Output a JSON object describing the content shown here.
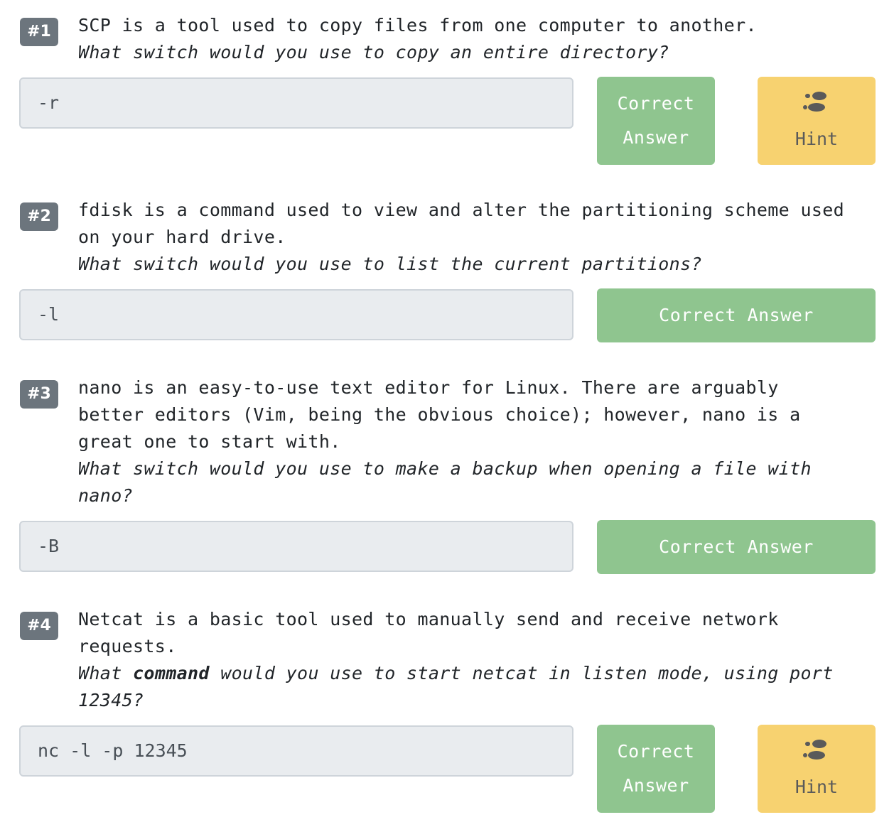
{
  "questions": [
    {
      "badge": "#1",
      "statement": "SCP is a tool used to copy files from one computer to another.",
      "ask": "What switch would you use to copy an entire directory?",
      "answer": "-r",
      "correct_label_line1": "Correct",
      "correct_label_line2": "Answer",
      "hint_label": "Hint",
      "hint_icon": "footprints-icon"
    },
    {
      "badge": "#2",
      "statement_line1": "fdisk is a command used to view and alter the partitioning scheme used",
      "statement_line2": "on your hard drive.",
      "ask": "What switch would you use to list the current partitions?",
      "answer": "-l",
      "correct_label": "Correct Answer"
    },
    {
      "badge": "#3",
      "statement_line1": "nano is an easy-to-use text editor for Linux. There are arguably",
      "statement_line2": "better editors (Vim, being the obvious choice); however, nano is a",
      "statement_line3": "great one to start with.",
      "ask_line1": "What switch would you use to make a backup when opening a file with",
      "ask_line2": "nano?",
      "answer": "-B",
      "correct_label": "Correct Answer"
    },
    {
      "badge": "#4",
      "statement_line1": "Netcat is a basic tool used to manually send and receive network",
      "statement_line2": "requests.",
      "ask_pre": "What ",
      "ask_bold": "command",
      "ask_post": " would you use to start netcat in listen mode, using port",
      "ask_line2": "12345?",
      "answer": "nc -l -p 12345",
      "correct_label_line1": "Correct",
      "correct_label_line2": "Answer",
      "hint_label": "Hint",
      "hint_icon": "footprints-icon"
    }
  ],
  "colors": {
    "badge": "#6c757d",
    "correct_button": "#8fc58f",
    "hint_button": "#f7d270",
    "field_bg": "#e9ecef"
  }
}
